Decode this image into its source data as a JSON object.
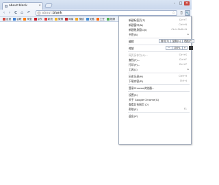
{
  "tab": {
    "title": "about:blank",
    "close": "×"
  },
  "window": {
    "minimize": "–",
    "maximize": "□",
    "close": "✕"
  },
  "toolbar": {
    "back": "‹",
    "forward": "›",
    "reload": "C",
    "home": "⌂",
    "undo": "↶",
    "url_scheme": "about:",
    "url_host": "blank",
    "star": "☆",
    "page_btn": "▯",
    "wrench": "🔧"
  },
  "bookmarks": [
    {
      "label": "百度",
      "color": "#d1453b"
    },
    {
      "label": "谷歌",
      "color": "#3a7fd5"
    },
    {
      "label": "淘宝",
      "color": "#ff7a00"
    },
    {
      "label": "京东",
      "color": "#c81623"
    },
    {
      "label": "新浪",
      "color": "#e53935"
    },
    {
      "label": "微博",
      "color": "#f6b01e"
    },
    {
      "label": "网易",
      "color": "#c62828"
    },
    {
      "label": "搜狐",
      "color": "#f5a623"
    },
    {
      "label": "优酷",
      "color": "#3d8bd6"
    },
    {
      "label": "土豆",
      "color": "#ff6600"
    },
    {
      "label": "视频",
      "color": "#4caf50"
    }
  ],
  "menu": {
    "new_tab": "新建标签页(T)",
    "new_tab_key": "Ctrl+T",
    "new_window": "新建窗口(N)",
    "new_window_key": "Ctrl+N",
    "new_incognito": "新建隐身窗口(I)",
    "new_incognito_key": "Ctrl+Shift+N",
    "bookmarks": "书签(B)",
    "edit": "编辑",
    "cut": "剪切(T)",
    "copy": "复制(C)",
    "paste": "粘贴(P)",
    "zoom": "缩放",
    "zoom_minus": "－",
    "zoom_value": "100%",
    "zoom_plus": "+",
    "save_as": "网页另存为(A)...",
    "save_as_key": "Ctrl+S",
    "find": "查找(F)...",
    "find_key": "Ctrl+F",
    "print": "打印(P)...",
    "print_key": "Ctrl+P",
    "tools": "工具(L)",
    "history": "历史记录(H)",
    "history_key": "Ctrl+H",
    "downloads": "下载内容(D)",
    "downloads_key": "Ctrl+J",
    "sign_in": "登录Chrome浏览器...",
    "settings": "设置(S)",
    "about": "关于 Google Chrome(G)",
    "background": "查看后台网页 (2)",
    "help": "帮助(E)",
    "help_key": "F1",
    "exit": "退出(X)"
  }
}
